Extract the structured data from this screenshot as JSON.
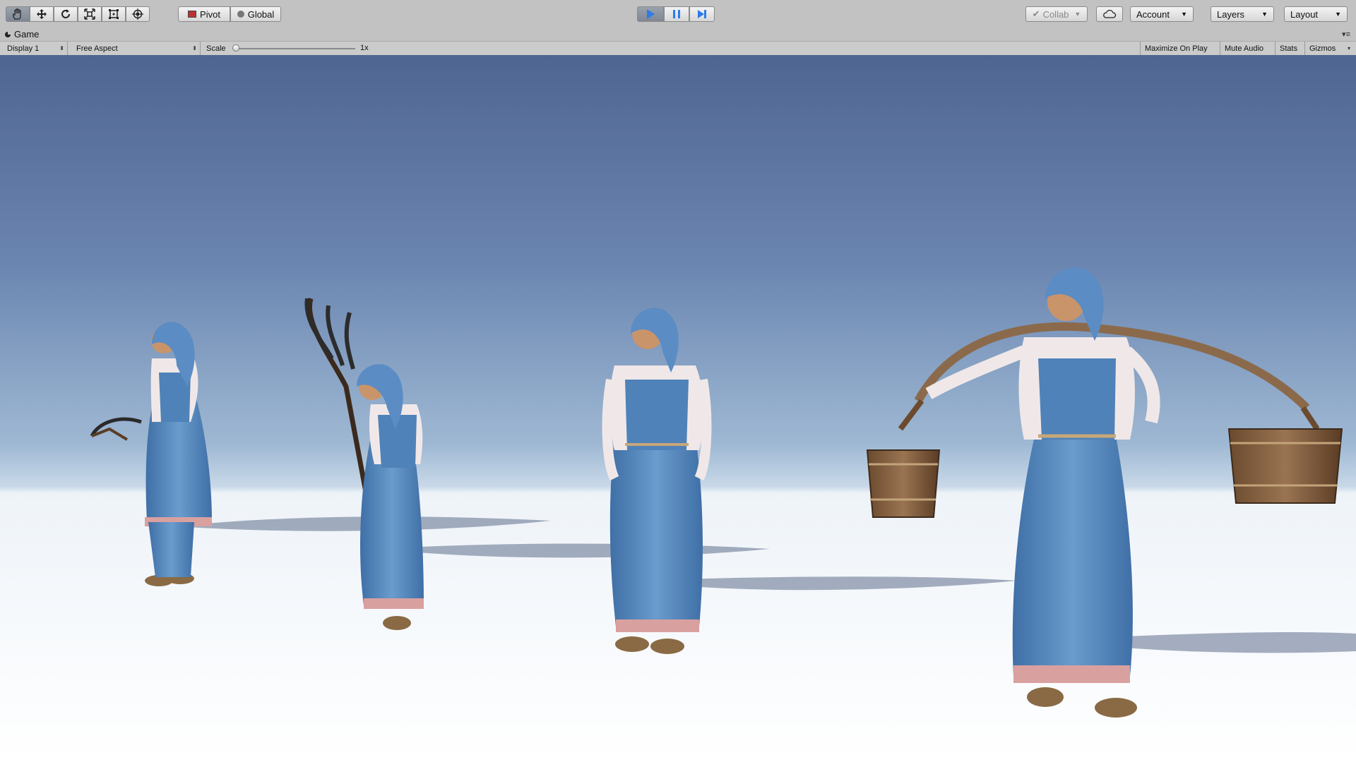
{
  "toolbar": {
    "tools": [
      "hand-tool",
      "move-tool",
      "rotate-tool",
      "scale-tool",
      "rect-tool",
      "transform-tool"
    ],
    "pivot_label": "Pivot",
    "global_label": "Global",
    "play_controls": [
      "play",
      "pause",
      "step"
    ],
    "collab_label": "Collab",
    "account_label": "Account",
    "layers_label": "Layers",
    "layout_label": "Layout",
    "colors": {
      "play_active": "#2f7be8",
      "toolbar_bg": "#c2c2c2"
    }
  },
  "game_tab": {
    "title": "Game"
  },
  "game_toolbar": {
    "display": "Display 1",
    "aspect": "Free Aspect",
    "scale_label": "Scale",
    "scale_value": "1x",
    "scale_level": 0.0,
    "maximize_on_play": "Maximize On Play",
    "mute_audio": "Mute Audio",
    "stats": "Stats",
    "gizmos": "Gizmos"
  },
  "scene": {
    "characters": [
      "woman-with-sickle",
      "woman-with-pitchfork",
      "woman-standing",
      "woman-with-yoke-buckets"
    ],
    "colors": {
      "sky_top": "#4f6591",
      "horizon": "#c8d8e8",
      "ground": "#ffffff",
      "dress": "#4f82b8"
    }
  }
}
